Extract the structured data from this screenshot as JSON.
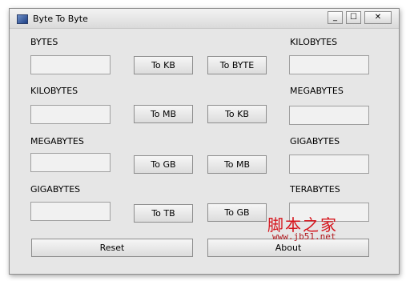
{
  "window": {
    "title": "Byte To Byte",
    "controls": {
      "minimize": "_",
      "maximize": "☐",
      "close": "✕"
    }
  },
  "rows": [
    {
      "left_label": "BYTES",
      "right_label": "KILOBYTES",
      "button_up": "To KB",
      "button_down": "To BYTE"
    },
    {
      "left_label": "KILOBYTES",
      "right_label": "MEGABYTES",
      "button_up": "To MB",
      "button_down": "To KB"
    },
    {
      "left_label": "MEGABYTES",
      "right_label": "GIGABYTES",
      "button_up": "To GB",
      "button_down": "To MB"
    },
    {
      "left_label": "GIGABYTES",
      "right_label": "TERABYTES",
      "button_up": "To TB",
      "button_down": "To GB"
    }
  ],
  "fields": {
    "bytes": "",
    "kilobytes_right": "",
    "kilobytes_left": "",
    "megabytes_right": "",
    "megabytes_left": "",
    "gigabytes_right": "",
    "gigabytes_left": "",
    "terabytes_right": ""
  },
  "footer": {
    "reset": "Reset",
    "about": "About"
  },
  "watermark": {
    "text": "脚本之家",
    "url": "www.jb51.net"
  }
}
